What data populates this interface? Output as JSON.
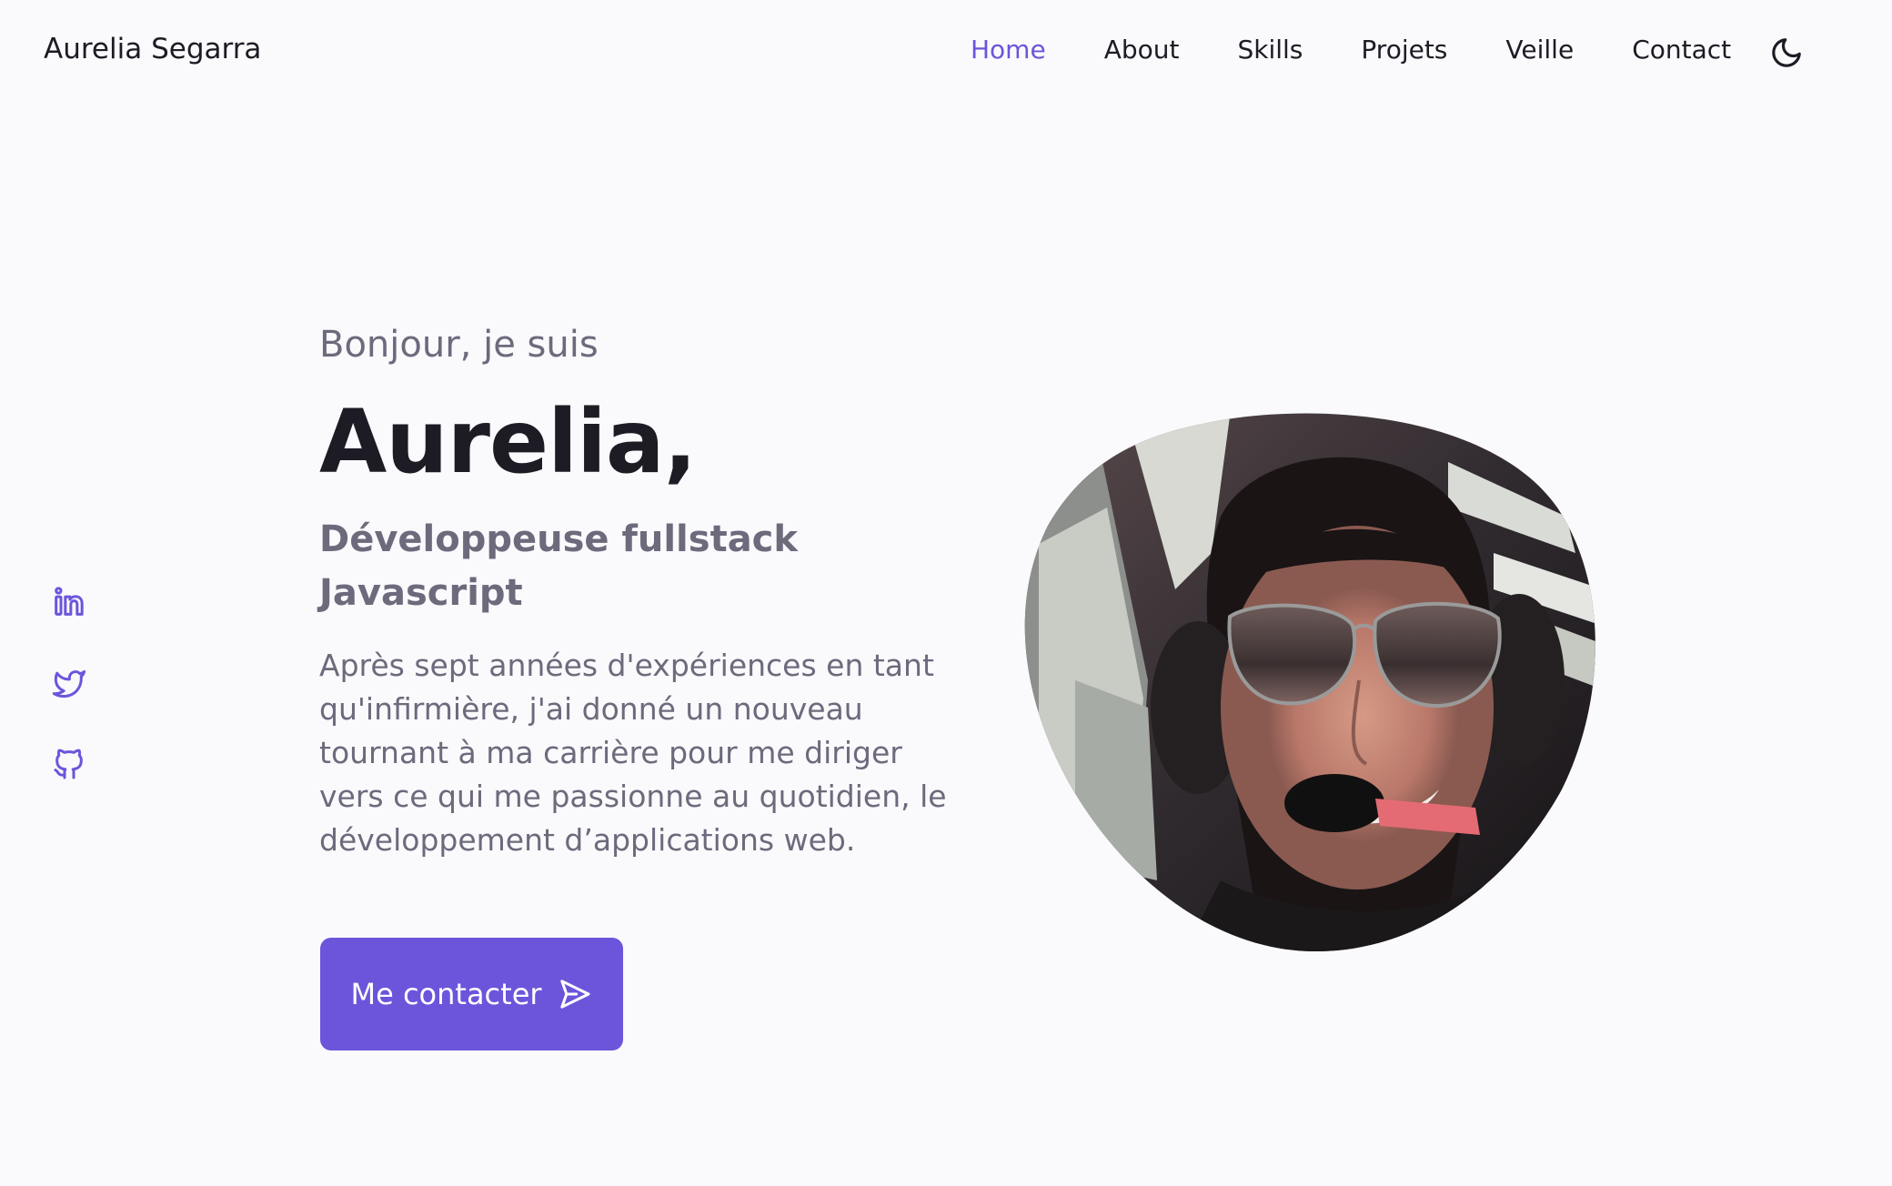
{
  "header": {
    "brand": "Aurelia Segarra",
    "nav": [
      {
        "label": "Home",
        "active": true
      },
      {
        "label": "About",
        "active": false
      },
      {
        "label": "Skills",
        "active": false
      },
      {
        "label": "Projets",
        "active": false
      },
      {
        "label": "Veille",
        "active": false
      },
      {
        "label": "Contact",
        "active": false
      }
    ],
    "theme_toggle_icon": "moon-icon"
  },
  "social": [
    {
      "icon": "linkedin-icon"
    },
    {
      "icon": "twitter-icon"
    },
    {
      "icon": "github-icon"
    }
  ],
  "hero": {
    "greeting": "Bonjour, je suis",
    "name": "Aurelia,",
    "role": "Développeuse fullstack Javascript",
    "description": "Après sept années d'expériences en tant qu'infirmière, j'ai donné un nouveau tournant à ma carrière pour me diriger vers ce qui me passionne au quotidien, le développement d’applications web.",
    "cta_label": "Me contacter",
    "cta_icon": "send-icon",
    "photo": "profile-photo"
  },
  "colors": {
    "accent": "#6c55db",
    "background": "#faf9fc",
    "text_primary": "#1d1b24",
    "text_secondary": "#6d6a7c"
  }
}
